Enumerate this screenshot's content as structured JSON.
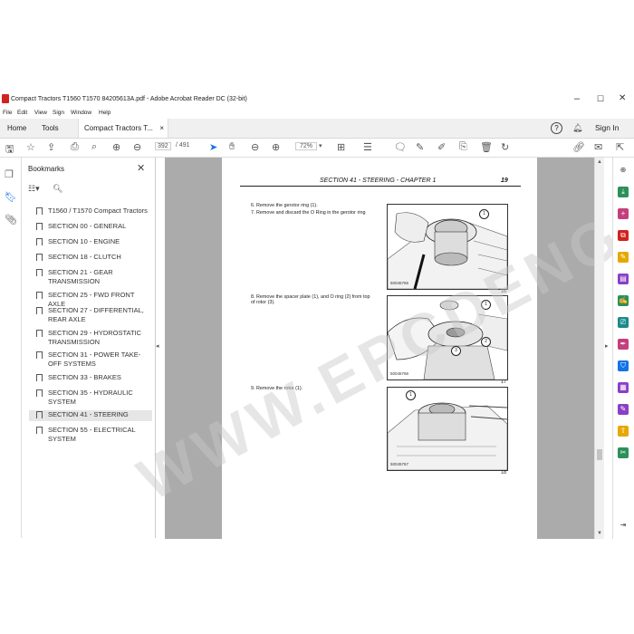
{
  "window": {
    "title": "Compact Tractors T1560 T1570 84205613A.pdf - Adobe Acrobat Reader DC (32-bit)",
    "controls": [
      "–",
      "☐",
      "✕"
    ]
  },
  "menu": [
    "File",
    "Edit",
    "View",
    "Sign",
    "Window",
    "Help"
  ],
  "tabs": {
    "home": "Home",
    "tools": "Tools",
    "doc": "Compact Tractors T...",
    "doc_close": "×"
  },
  "header_right": {
    "help": "?",
    "sign_in": "Sign In"
  },
  "toolbar": {
    "current_page": "392",
    "total_pages": "/ 491",
    "zoom": "72%"
  },
  "bookmarks": {
    "title": "Bookmarks",
    "items": [
      {
        "label": "T1560 / T1570 Compact Tractors"
      },
      {
        "label": "SECTION 00 - GENERAL"
      },
      {
        "label": "SECTION 10 - ENGINE"
      },
      {
        "label": "SECTION 18 - CLUTCH"
      },
      {
        "label": "SECTION 21 - GEAR TRANSMISSION"
      },
      {
        "label": "SECTION 25 - FWD FRONT AXLE"
      },
      {
        "label": "SECTION 27 - DIFFERENTIAL, REAR AXLE"
      },
      {
        "label": "SECTION 29 - HYDROSTATIC TRANSMISSION"
      },
      {
        "label": "SECTION 31 - POWER TAKE-OFF SYSTEMS"
      },
      {
        "label": "SECTION 33 - BRAKES"
      },
      {
        "label": "SECTION 35 - HYDRAULIC SYSTEM"
      },
      {
        "label": "SECTION 41 - STEERING"
      },
      {
        "label": "SECTION 55 - ELECTRICAL SYSTEM"
      }
    ]
  },
  "page": {
    "header": "SECTION 41 - STEERING - CHAPTER 1",
    "page_number": "19",
    "steps": [
      "6.   Remove the gerotor ring (1).",
      "7.   Remove and discard the O Ring in the gerotor ring",
      "8.   Remove the spacer plate (1), and O ring (2) from top of rotor (3).",
      "9.   Remove the rotor (1)."
    ],
    "figures": [
      {
        "id": "50045765",
        "number": "16",
        "callouts": [
          "1"
        ]
      },
      {
        "id": "50045766",
        "number": "17",
        "callouts": [
          "1",
          "2",
          "3"
        ]
      },
      {
        "id": "50045767",
        "number": "18",
        "callouts": [
          "1"
        ]
      }
    ]
  },
  "watermark": "WWW.EPCDENG.COM",
  "colors": {
    "accent": "#1473e6",
    "pdf_red": "#d1221f",
    "doc_bg": "#ababab"
  }
}
